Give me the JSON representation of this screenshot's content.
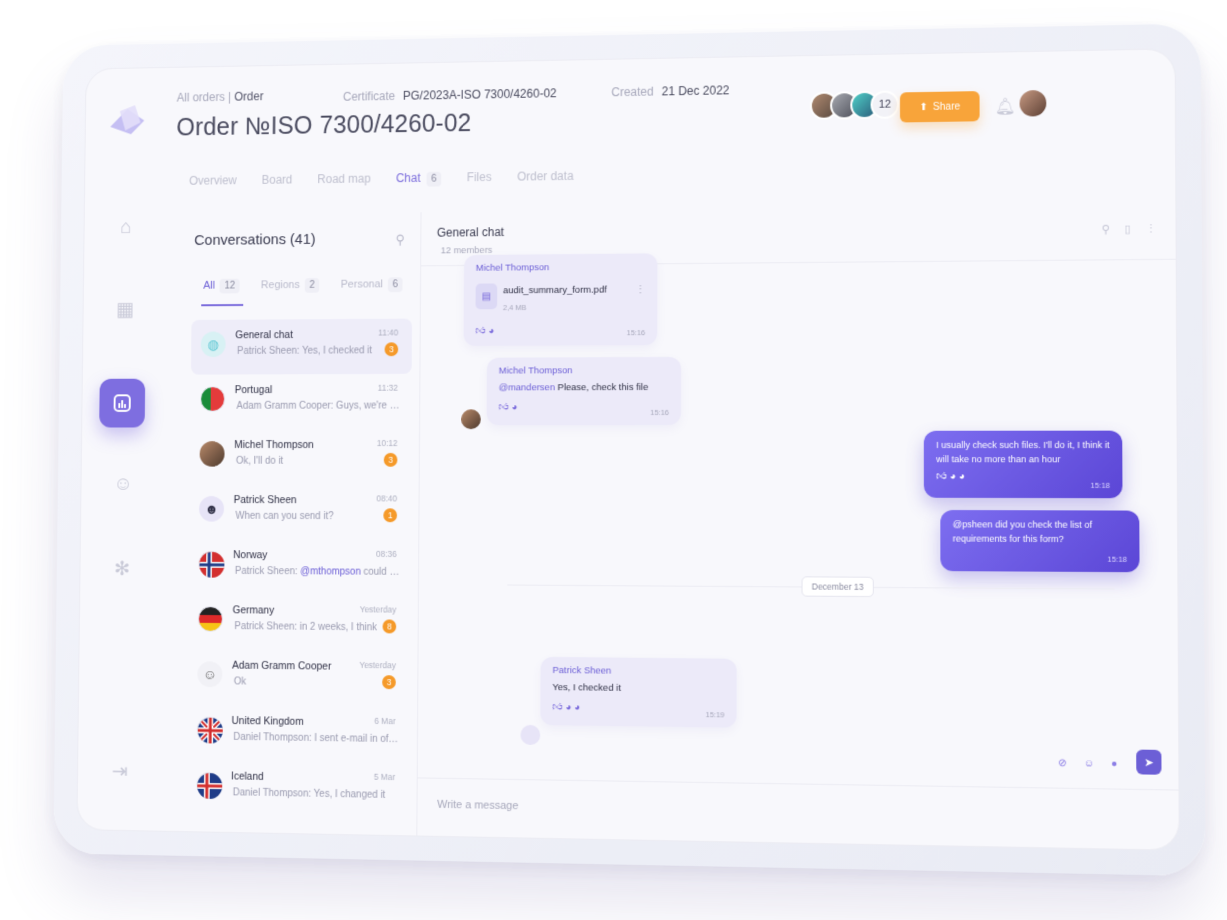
{
  "breadcrumb": {
    "root": "All orders",
    "sep": "|",
    "current": "Order"
  },
  "title": "Order №ISO 7300/4260-02",
  "certificate": {
    "label": "Certificate",
    "value": "PG/2023A-ISO 7300/4260-02"
  },
  "created": {
    "label": "Created",
    "value": "21 Dec 2022"
  },
  "participants_count": "12",
  "share_label": "Share",
  "tabs": [
    {
      "label": "Overview"
    },
    {
      "label": "Board"
    },
    {
      "label": "Road map"
    },
    {
      "label": "Chat",
      "count": "6"
    },
    {
      "label": "Files"
    },
    {
      "label": "Order data"
    }
  ],
  "conversations": {
    "title": "Conversations (41)",
    "filters": [
      {
        "label": "All",
        "count": "12"
      },
      {
        "label": "Regions",
        "count": "2"
      },
      {
        "label": "Personal",
        "count": "6"
      }
    ],
    "items": [
      {
        "name": "General chat",
        "msg": "Patrick Sheen: Yes, I checked it",
        "time": "11:40",
        "badge": "3"
      },
      {
        "name": "Portugal",
        "msg": "Adam Gramm Cooper: Guys, we're expecting...",
        "time": "11:32",
        "badge": ""
      },
      {
        "name": "Michel Thompson",
        "msg": "Ok, I'll do it",
        "time": "10:12",
        "badge": "3"
      },
      {
        "name": "Patrick Sheen",
        "msg": "When can you send it?",
        "time": "08:40",
        "badge": "1"
      },
      {
        "name": "Norway",
        "msg_prefix": "Patrick Sheen: ",
        "mention": "@mthompson",
        "msg_suffix": " could you mess...",
        "time": "08:36",
        "badge": ""
      },
      {
        "name": "Germany",
        "msg": "Patrick Sheen: in 2 weeks, I think",
        "time": "Yesterday",
        "badge": "8"
      },
      {
        "name": "Adam Gramm Cooper",
        "msg": "Ok",
        "time": "Yesterday",
        "badge": "3"
      },
      {
        "name": "United Kingdom",
        "msg": "Daniel Thompson: I sent e-mail in office on pr...",
        "time": "6 Mar",
        "badge": ""
      },
      {
        "name": "Iceland",
        "msg": "Daniel Thompson: Yes, I changed it",
        "time": "5 Mar",
        "badge": ""
      }
    ]
  },
  "chat": {
    "title": "General chat",
    "members": "12 members",
    "messages": [
      {
        "author": "Michel Thompson",
        "file_name": "audit_summary_form.pdf",
        "file_size": "2,4 MB",
        "time": "15:16"
      },
      {
        "author": "Michel Thompson",
        "mention": "@mandersen",
        "text": " Please, check this file",
        "time": "15:16"
      },
      {
        "text": "I usually check such files. I'll do it, I think it will take no more than an hour",
        "time": "15:18"
      },
      {
        "text": "@psheen did you check the list of requirements for this form?",
        "time": "15:18"
      },
      {
        "author": "Patrick Sheen",
        "text": "Yes, I checked it",
        "time": "15:19"
      }
    ],
    "date_separator": "December 13",
    "composer_placeholder": "Write a message"
  },
  "colors": {
    "accent": "#7b6cdc",
    "orange": "#f8a43a",
    "badge": "#f59a2a"
  }
}
